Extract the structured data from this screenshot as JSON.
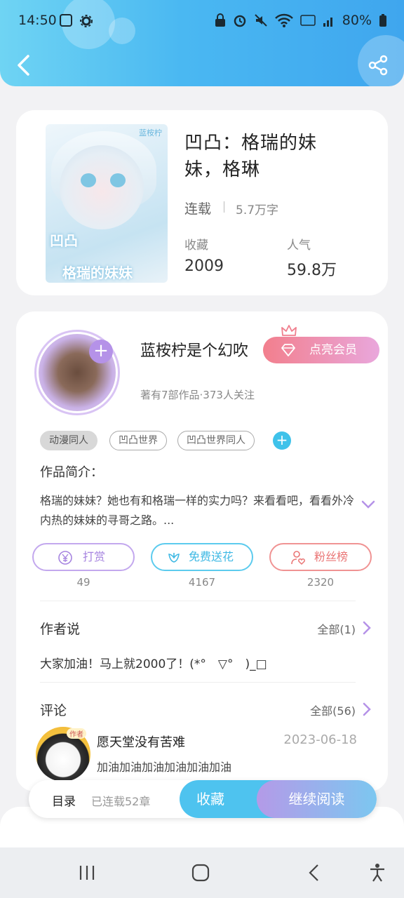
{
  "status_bar": {
    "time": "14:50",
    "battery": "80%",
    "left_icons": [
      "voicemail-icon",
      "gear-icon"
    ],
    "right_icons": [
      "lock-icon",
      "alarm-icon",
      "mute-icon",
      "wifi-icon",
      "volte-icon",
      "signal-icon",
      "battery-icon"
    ]
  },
  "header": {
    "back_icon": "chevron-left-icon",
    "share_icon": "share-icon",
    "colors": {
      "from": "#6fd4f3",
      "to": "#3fa6ee"
    }
  },
  "book": {
    "cover_text_1": "凹凸",
    "cover_text_2": "格瑞的妹妹",
    "cover_tag": "蓝桉柠",
    "title": "凹凸：格瑞的妹妹，格琳",
    "status": "连载",
    "words": "5.7万字",
    "stats": [
      {
        "label": "收藏",
        "value": "2009"
      },
      {
        "label": "人气",
        "value": "59.8万"
      }
    ]
  },
  "author": {
    "name": "蓝桉柠是个幻吹",
    "vip_label": "点亮会员",
    "meta": "著有7部作品·373人关注",
    "follow_symbol": "+"
  },
  "tags": [
    "动漫同人",
    "凹凸世界",
    "凹凸世界同人"
  ],
  "tag_add_symbol": "+",
  "intro": {
    "heading": "作品简介：",
    "text": "格瑞的妹妹？她也有和格瑞一样的实力吗？来看看吧，看看外冷内热的妹妹的寻哥之路。..."
  },
  "actions": [
    {
      "label": "打赏",
      "count": "49",
      "color": "#b592e8",
      "icon": "yen-coin-icon"
    },
    {
      "label": "免费送花",
      "count": "4167",
      "color": "#3fc2ea",
      "icon": "flower-icon"
    },
    {
      "label": "粉丝榜",
      "count": "2320",
      "color": "#ee7f7f",
      "icon": "user-heart-icon"
    }
  ],
  "author_says": {
    "title": "作者说",
    "link": "全部(1)",
    "text": "大家加油！马上就2000了！(*°　▽°　)_□"
  },
  "comments": {
    "title": "评论",
    "link": "全部(56)",
    "items": [
      {
        "user": "愿天堂没有苦难",
        "date": "2023-06-18",
        "text": "加油加油加油加油加油加油",
        "badge": "作者"
      }
    ]
  },
  "bottom_bar": {
    "toc": "目录",
    "chapters": "已连载52章",
    "collect": "收藏",
    "read": "继续阅读"
  },
  "nav": [
    "recents-icon",
    "home-icon",
    "back-icon",
    "accessibility-icon"
  ]
}
